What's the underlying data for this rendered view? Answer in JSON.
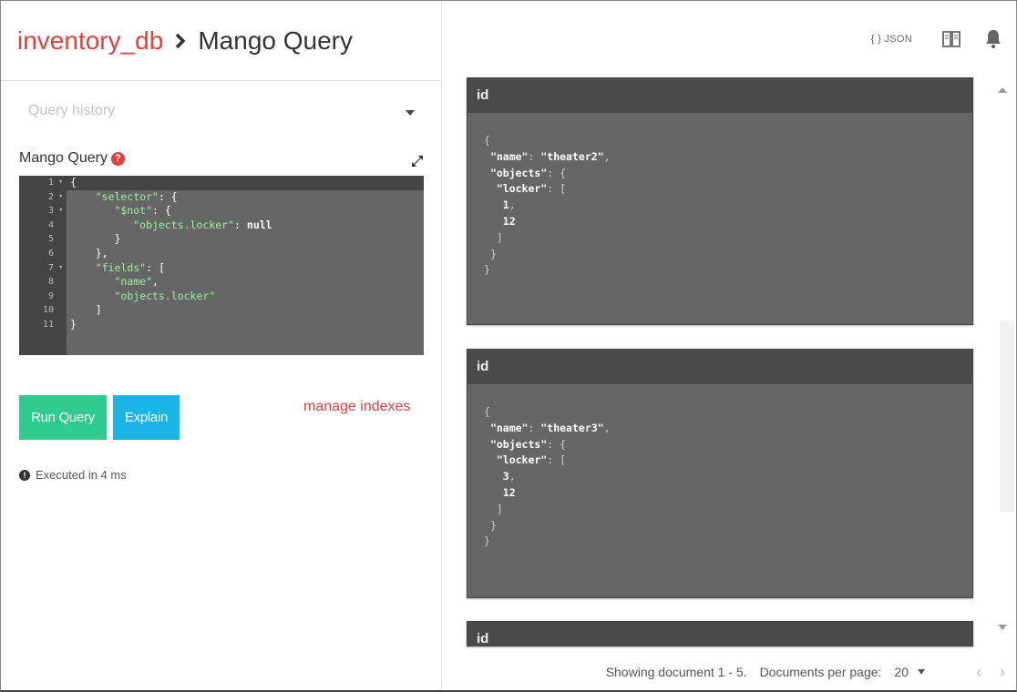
{
  "header": {
    "database": "inventory_db",
    "page_title": "Mango Query",
    "json_link": "{ } JSON"
  },
  "left": {
    "history_placeholder": "Query history",
    "mango_label": "Mango Query",
    "editor_lines": [
      {
        "n": "1",
        "text": "{"
      },
      {
        "n": "2",
        "text": "    \"selector\": {"
      },
      {
        "n": "3",
        "text": "       \"$not\": {"
      },
      {
        "n": "4",
        "text": "          \"objects.locker\": null"
      },
      {
        "n": "5",
        "text": "       }"
      },
      {
        "n": "6",
        "text": "    },"
      },
      {
        "n": "7",
        "text": "    \"fields\": ["
      },
      {
        "n": "8",
        "text": "       \"name\","
      },
      {
        "n": "9",
        "text": "       \"objects.locker\""
      },
      {
        "n": "10",
        "text": "    ]"
      },
      {
        "n": "11",
        "text": "}"
      }
    ],
    "run_button": "Run Query",
    "explain_button": "Explain",
    "manage_indexes": "manage indexes",
    "executed": "Executed in 4 ms"
  },
  "results": [
    {
      "header": "id",
      "name": "theater2",
      "locker": [
        "1",
        "12"
      ]
    },
    {
      "header": "id",
      "name": "theater3",
      "locker": [
        "3",
        "12"
      ]
    },
    {
      "header": "id"
    }
  ],
  "footer": {
    "showing": "Showing document 1 - 5.",
    "per_page_label": "Documents per page:",
    "per_page_value": "20"
  },
  "colors": {
    "accent_red": "#e33f3b",
    "run_green": "#2ecc8f",
    "explain_blue": "#1ab4e8"
  }
}
